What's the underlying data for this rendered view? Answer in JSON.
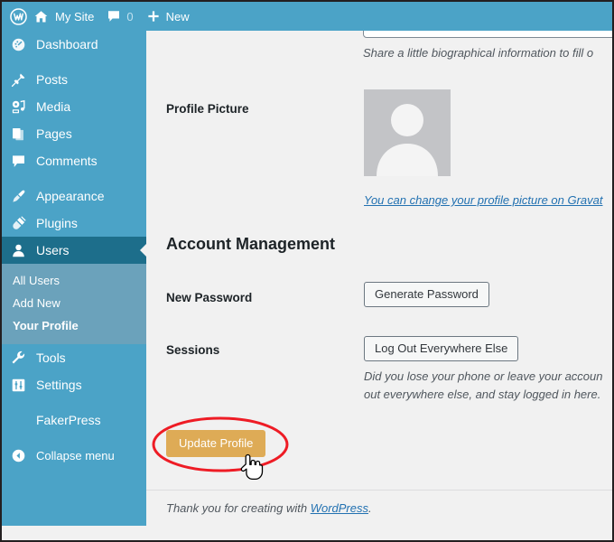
{
  "adminbar": {
    "logo_icon": "wordpress-logo-icon",
    "site_icon": "home-icon",
    "site_label": "My Site",
    "comments_icon": "comment-bubble-icon",
    "comments_count": "0",
    "new_icon": "plus-icon",
    "new_label": "New"
  },
  "sidebar": {
    "items": [
      {
        "label": "Dashboard",
        "icon": "dashboard-gauge-icon",
        "current": false
      },
      {
        "label": "Posts",
        "icon": "pushpin-icon",
        "current": false
      },
      {
        "label": "Media",
        "icon": "media-icon",
        "current": false
      },
      {
        "label": "Pages",
        "icon": "pages-icon",
        "current": false
      },
      {
        "label": "Comments",
        "icon": "comment-bubble-icon",
        "current": false
      },
      {
        "label": "Appearance",
        "icon": "paintbrush-icon",
        "current": false
      },
      {
        "label": "Plugins",
        "icon": "plug-icon",
        "current": false
      },
      {
        "label": "Users",
        "icon": "user-icon",
        "current": true
      },
      {
        "label": "Tools",
        "icon": "wrench-icon",
        "current": false
      },
      {
        "label": "Settings",
        "icon": "settings-sliders-icon",
        "current": false
      }
    ],
    "submenu": [
      {
        "label": "All Users",
        "current": false
      },
      {
        "label": "Add New",
        "current": false
      },
      {
        "label": "Your Profile",
        "current": true
      }
    ],
    "plugin_item": "FakerPress",
    "collapse_label": "Collapse menu",
    "collapse_icon": "chevron-left-circle-icon"
  },
  "content": {
    "bio_description": "Share a little biographical information to fill o",
    "profile_picture_label": "Profile Picture",
    "avatar_icon": "default-avatar-icon",
    "gravatar_link": "You can change your profile picture on Gravat",
    "account_management_heading": "Account Management",
    "new_password_label": "New Password",
    "generate_password_button": "Generate Password",
    "sessions_label": "Sessions",
    "logout_everywhere_button": "Log Out Everywhere Else",
    "sessions_description_line1": "Did you lose your phone or leave your accoun",
    "sessions_description_line2": "out everywhere else, and stay logged in here.",
    "update_profile_button": "Update Profile",
    "footer_prefix": "Thank you for creating with ",
    "footer_link": "WordPress",
    "footer_suffix": "."
  },
  "annotation": {
    "shape": "red-ellipse-highlight",
    "color": "#ee1c25",
    "cursor_icon": "pointing-hand-cursor"
  },
  "colors": {
    "adminbar_bg": "#4ba3c7",
    "sidebar_bg": "#4ba3c7",
    "sidebar_current_bg": "#1d6e8b",
    "submenu_bg": "#6ba2bb",
    "content_bg": "#f1f1f1",
    "update_button_bg": "#deab56",
    "link": "#2271b1"
  }
}
